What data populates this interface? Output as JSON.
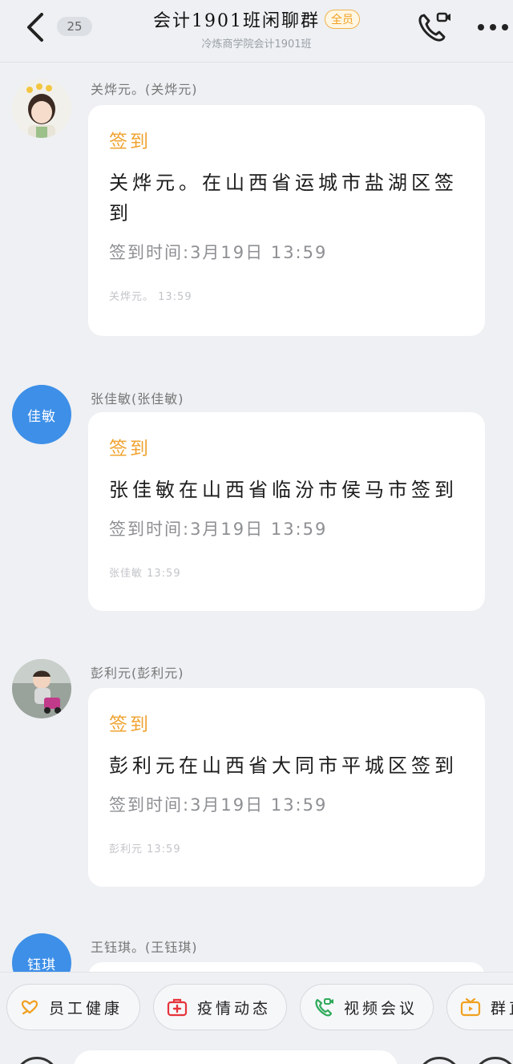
{
  "header": {
    "unread_count": "25",
    "group_name": "会计1901班闲聊群",
    "member_badge": "全员",
    "subtitle": "冷炼商学院会计1901班"
  },
  "messages": [
    {
      "sender": "关烨元。(关烨元)",
      "avatar_text": "",
      "card_title": "签到",
      "card_body": "关烨元。在山西省运城市盐湖区签到",
      "card_time": "签到时间:3月19日  13:59",
      "card_footer": "关烨元。 13:59"
    },
    {
      "sender": "张佳敏(张佳敏)",
      "avatar_text": "佳敏",
      "card_title": "签到",
      "card_body": "张佳敏在山西省临汾市侯马市签到",
      "card_time": "签到时间:3月19日  13:59",
      "card_footer": "张佳敏 13:59"
    },
    {
      "sender": "彭利元(彭利元)",
      "avatar_text": "",
      "card_title": "签到",
      "card_body": "彭利元在山西省大同市平城区签到",
      "card_time": "签到时间:3月19日  13:59",
      "card_footer": "彭利元 13:59"
    },
    {
      "sender": "王钰琪。(王钰琪)",
      "avatar_text": "钰琪"
    }
  ],
  "quick_actions": [
    {
      "label": "员工健康",
      "icon": "heart-hand-icon",
      "color": "#f0a020"
    },
    {
      "label": "疫情动态",
      "icon": "medical-kit-icon",
      "color": "#e5343a"
    },
    {
      "label": "视频会议",
      "icon": "video-call-icon",
      "color": "#2eaa5a"
    },
    {
      "label": "群直播",
      "icon": "tv-icon",
      "color": "#f0a020"
    }
  ],
  "colors": {
    "accent_orange": "#f0a330",
    "avatar_blue": "#3d8fe8",
    "background": "#eef0f3"
  }
}
